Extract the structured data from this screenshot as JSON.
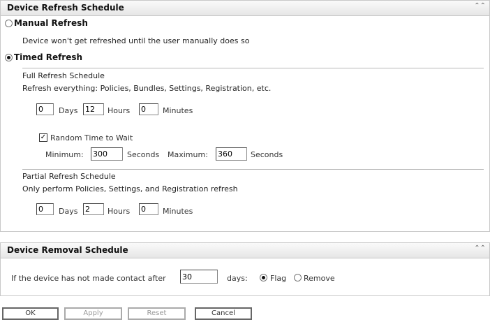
{
  "refresh": {
    "title": "Device Refresh Schedule",
    "manual_label": "Manual Refresh",
    "manual_desc": "Device won't get refreshed until the user manually does so",
    "manual_selected": false,
    "timed_label": "Timed Refresh",
    "timed_selected": true,
    "full": {
      "title": "Full Refresh Schedule",
      "desc": "Refresh everything: Policies, Bundles, Settings, Registration, etc.",
      "days": "0",
      "hours": "12",
      "minutes": "0",
      "days_label": "Days",
      "hours_label": "Hours",
      "minutes_label": "Minutes",
      "random_label": "Random Time to Wait",
      "random_checked": true,
      "min_label": "Minimum:",
      "min_value": "300",
      "max_label": "Maximum:",
      "max_value": "360",
      "seconds_label": "Seconds"
    },
    "partial": {
      "title": "Partial Refresh Schedule",
      "desc": "Only perform Policies, Settings, and Registration refresh",
      "days": "0",
      "hours": "2",
      "minutes": "0",
      "days_label": "Days",
      "hours_label": "Hours",
      "minutes_label": "Minutes"
    }
  },
  "removal": {
    "title": "Device Removal Schedule",
    "prefix": "If the device has not made contact after",
    "days_value": "30",
    "days_label": "days:",
    "flag_label": "Flag",
    "remove_label": "Remove",
    "selected": "Flag"
  },
  "icons": {
    "collapse": "«"
  },
  "buttons": {
    "ok": "OK",
    "apply": "Apply",
    "reset": "Reset",
    "cancel": "Cancel"
  }
}
